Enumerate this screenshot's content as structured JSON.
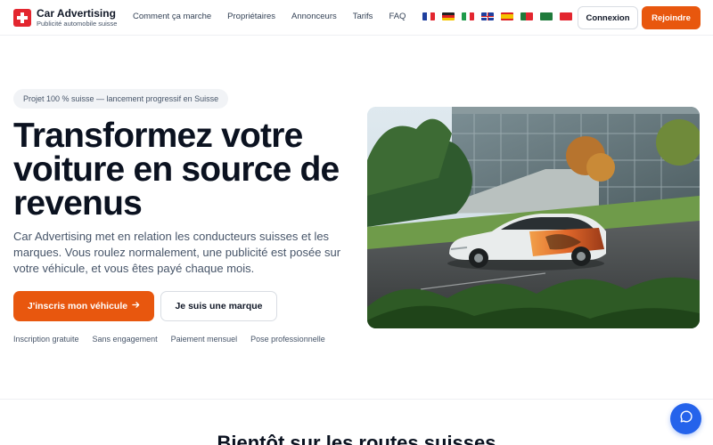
{
  "brand": {
    "title": "Car Advertising",
    "subtitle": "Publicité automobile suisse",
    "icon": "swiss-cross-icon",
    "color": "#e3262f"
  },
  "nav": {
    "items": [
      {
        "label": "Comment ça marche"
      },
      {
        "label": "Propriétaires"
      },
      {
        "label": "Annonceurs"
      },
      {
        "label": "Tarifs"
      },
      {
        "label": "FAQ"
      }
    ]
  },
  "languages": [
    "fr",
    "de",
    "it",
    "en",
    "es",
    "pt",
    "ar",
    "tr"
  ],
  "header": {
    "login_label": "Connexion",
    "join_label": "Rejoindre"
  },
  "hero": {
    "badge": "Projet 100 % suisse — lancement progressif en Suisse",
    "title": "Transformez votre voiture en source de revenus",
    "description": "Car Advertising met en relation les conducteurs suisses et les marques. Vous roulez normalement, une publicité est posée sur votre véhicule, et vous êtes payé chaque mois.",
    "primary_cta": "J'inscris mon véhicule",
    "primary_cta_icon": "arrow-right-icon",
    "secondary_cta": "Je suis une marque",
    "features": [
      "Inscription gratuite",
      "Sans engagement",
      "Paiement mensuel",
      "Pose professionnelle"
    ]
  },
  "next_section": {
    "title": "Bientôt sur les routes suisses"
  },
  "chat": {
    "icon": "chat-bubble-icon"
  },
  "colors": {
    "accent": "#e8570e",
    "chat": "#2563eb",
    "heading": "#0b1220",
    "body": "#475569"
  }
}
